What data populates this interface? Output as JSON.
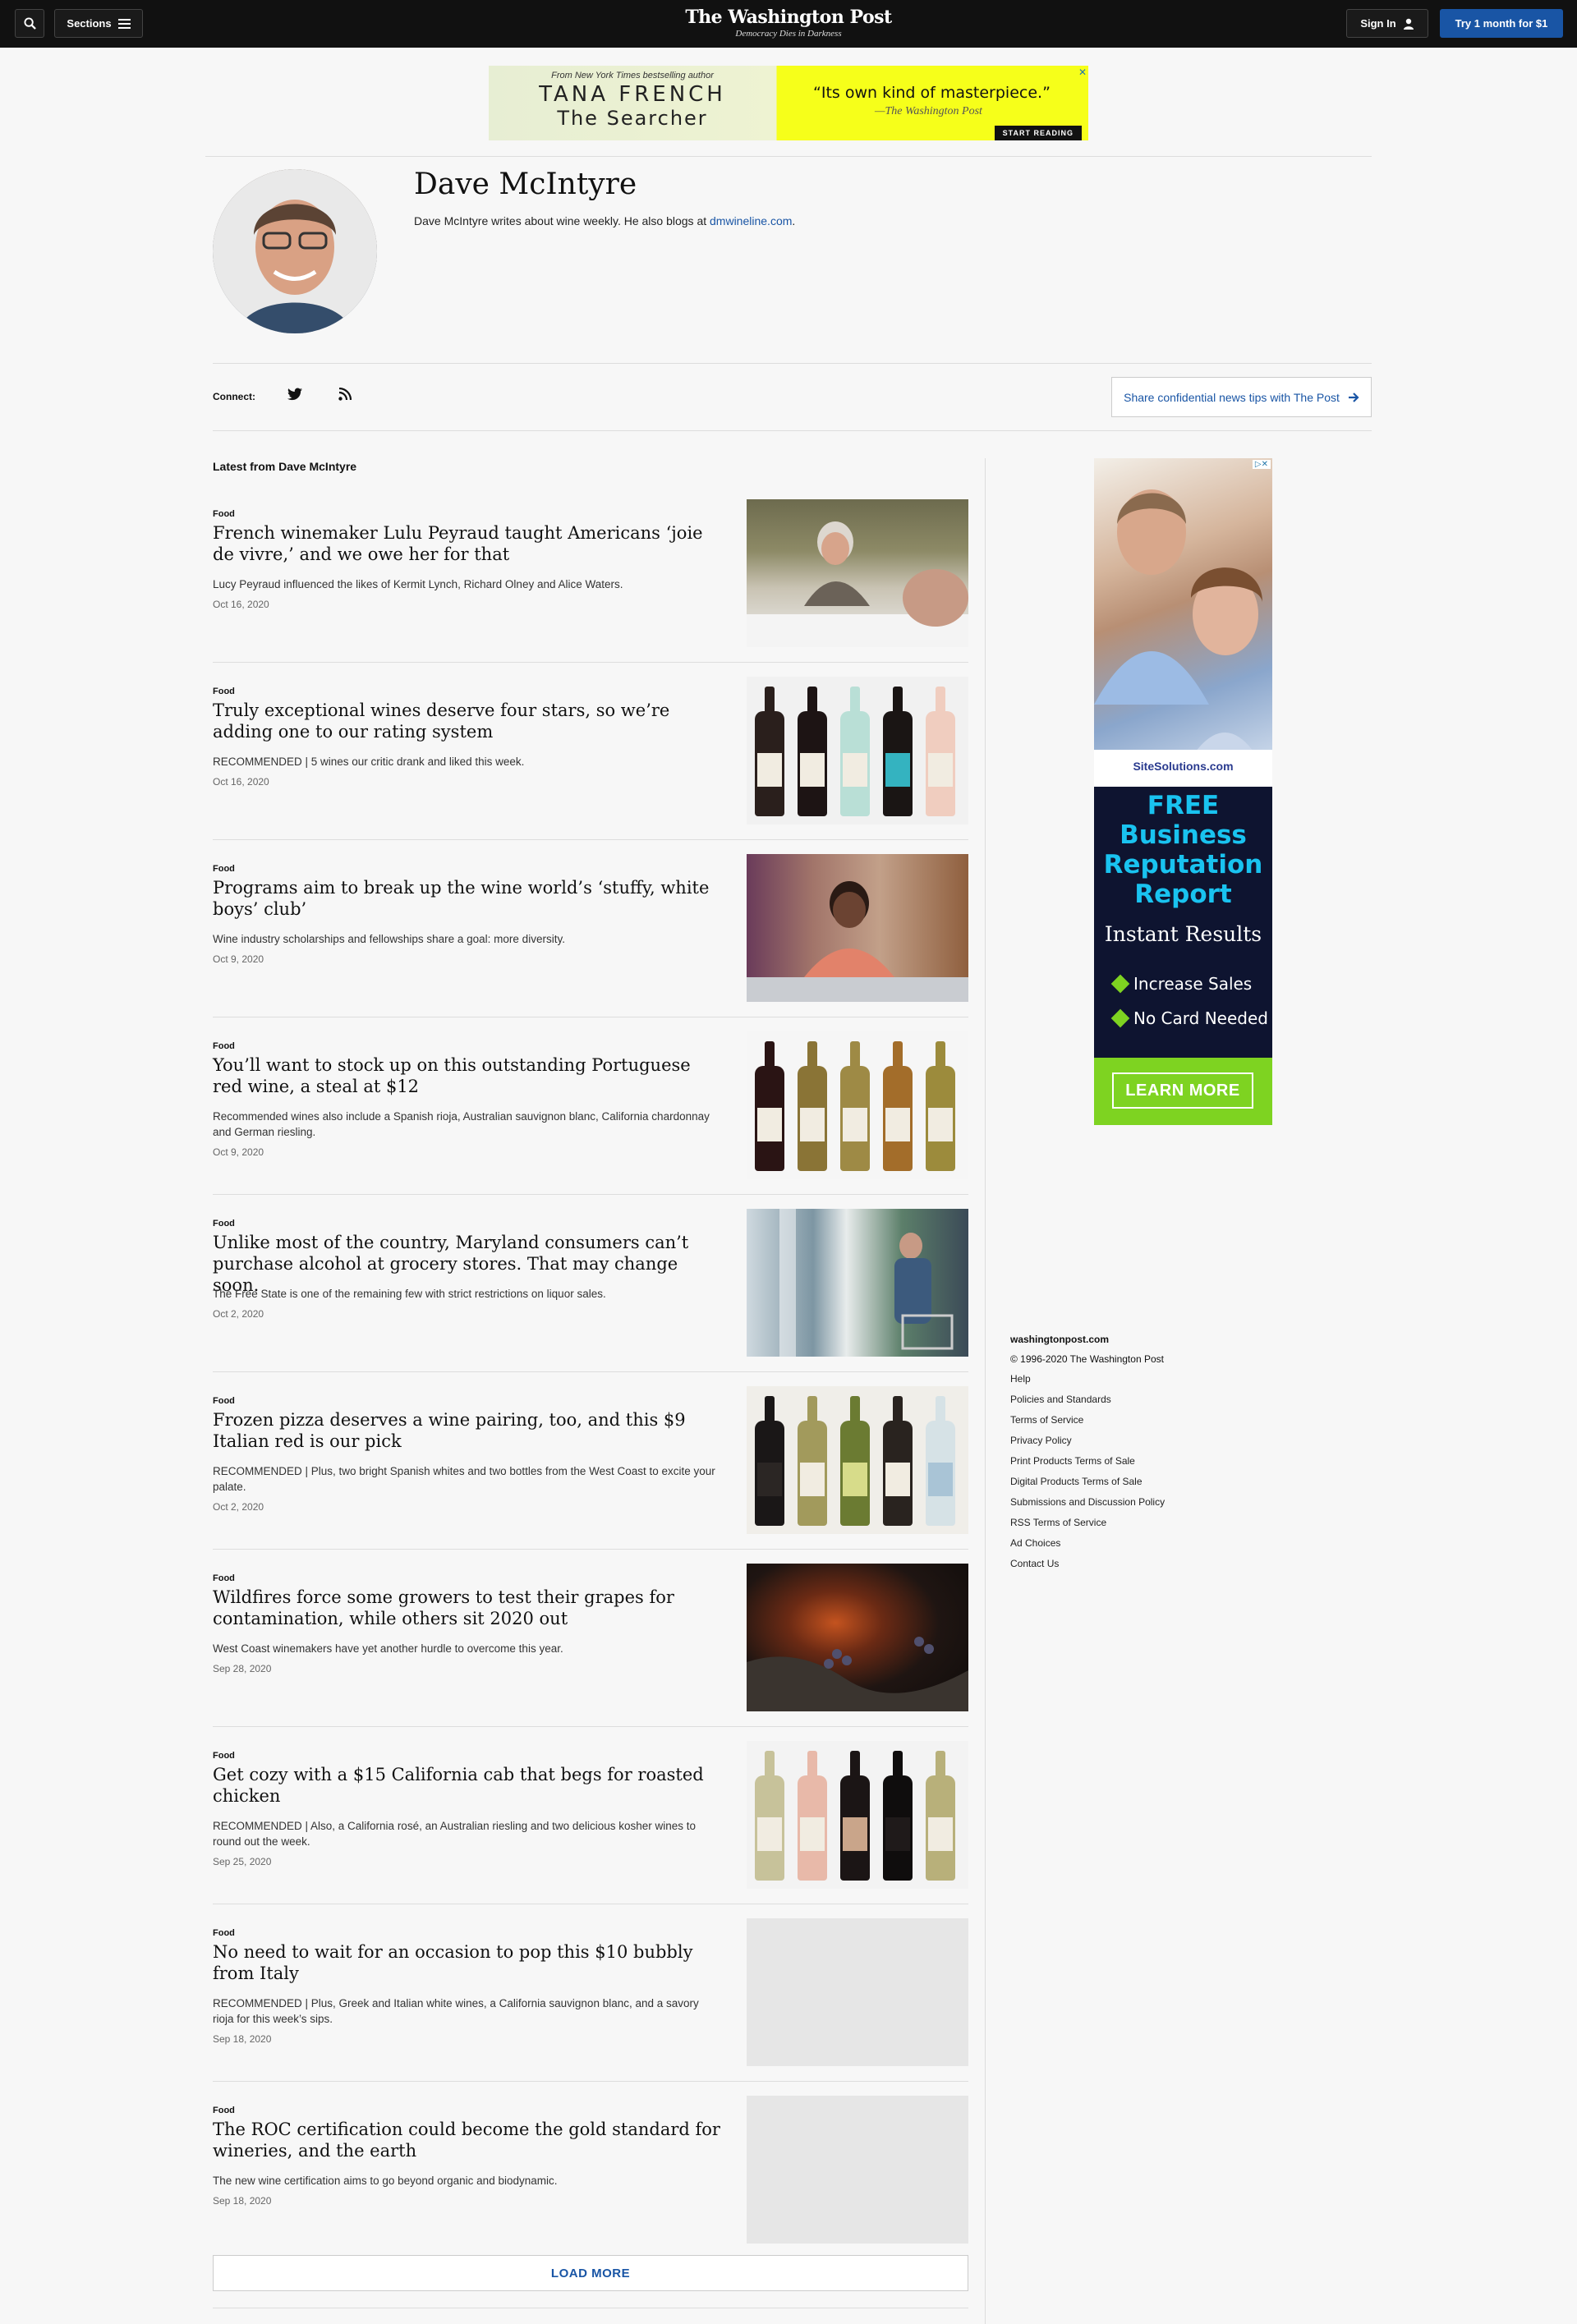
{
  "header": {
    "sections_label": "Sections",
    "logo": "The Washington Post",
    "tagline": "Democracy Dies in Darkness",
    "signin_label": "Sign In",
    "try_label": "Try 1 month for $1"
  },
  "top_ad": {
    "from_text": "From New York Times bestselling author",
    "author": "TANA FRENCH",
    "book": "The Searcher",
    "quote": "“Its own kind of masterpiece.”",
    "quote_source": "—The Washington Post",
    "cta": "START READING"
  },
  "author": {
    "name": "Dave McIntyre",
    "bio_prefix": "Dave McIntyre writes about wine weekly. He also blogs at ",
    "bio_link": "dmwineline.com",
    "bio_suffix": "."
  },
  "connect": {
    "label": "Connect:",
    "tips_button": "Share confidential news tips with The Post"
  },
  "latest_label": "Latest from Dave McIntyre",
  "articles": [
    {
      "kicker": "Food",
      "headline": "French winemaker Lulu Peyraud taught Americans ‘joie de vivre,’ and we owe her for that",
      "blurb": "Lucy Peyraud influenced the likes of Kermit Lynch, Richard Olney and Alice Waters.",
      "date": "Oct 16, 2020"
    },
    {
      "kicker": "Food",
      "headline": "Truly exceptional wines deserve four stars, so we’re adding one to our rating system",
      "blurb": "RECOMMENDED | 5 wines our critic drank and liked this week.",
      "date": "Oct 16, 2020"
    },
    {
      "kicker": "Food",
      "headline": "Programs aim to break up the wine world’s ‘stuffy, white boys’ club’",
      "blurb": "Wine industry scholarships and fellowships share a goal: more diversity.",
      "date": "Oct 9, 2020"
    },
    {
      "kicker": "Food",
      "headline": "You’ll want to stock up on this outstanding Portuguese red wine, a steal at $12",
      "blurb": "Recommended wines also include a Spanish rioja, Australian sauvignon blanc, California chardonnay and German riesling.",
      "date": "Oct 9, 2020"
    },
    {
      "kicker": "Food",
      "headline": "Unlike most of the country, Maryland consumers can’t purchase alcohol at grocery stores. That may change soon.",
      "blurb": "The Free State is one of the remaining few with strict restrictions on liquor sales.",
      "date": "Oct 2, 2020"
    },
    {
      "kicker": "Food",
      "headline": "Frozen pizza deserves a wine pairing, too, and this $9 Italian red is our pick",
      "blurb": "RECOMMENDED | Plus, two bright Spanish whites and two bottles from the West Coast to excite your palate.",
      "date": "Oct 2, 2020"
    },
    {
      "kicker": "Food",
      "headline": "Wildfires force some growers to test their grapes for contamination, while others sit 2020 out",
      "blurb": "West Coast winemakers have yet another hurdle to overcome this year.",
      "date": "Sep 28, 2020"
    },
    {
      "kicker": "Food",
      "headline": "Get cozy with a $15 California cab that begs for roasted chicken",
      "blurb": "RECOMMENDED | Also, a California rosé, an Australian riesling and two delicious kosher wines to round out the week.",
      "date": "Sep 25, 2020"
    },
    {
      "kicker": "Food",
      "headline": "No need to wait for an occasion to pop this $10 bubbly from Italy",
      "blurb": "RECOMMENDED | Plus, Greek and Italian white wines, a California sauvignon blanc, and a savory rioja for this week’s sips.",
      "date": "Sep 18, 2020"
    },
    {
      "kicker": "Food",
      "headline": "The ROC certification could become the gold standard for wineries, and the earth",
      "blurb": "The new wine certification aims to go beyond organic and biodynamic.",
      "date": "Sep 18, 2020"
    }
  ],
  "load_more": "LOAD MORE",
  "side_ad": {
    "site": "SiteSolutions.com",
    "free_lines": [
      "FREE",
      "Business",
      "Reputation",
      "Report"
    ],
    "instant": "Instant Results",
    "bullets": [
      "Increase Sales",
      "No Card Needed"
    ],
    "cta": "LEARN MORE"
  },
  "footer": {
    "site": "washingtonpost.com",
    "copyright": "© 1996-2020 The Washington Post",
    "links": [
      "Help",
      "Policies and Standards",
      "Terms of Service",
      "Privacy Policy",
      "Print Products Terms of Sale",
      "Digital Products Terms of Sale",
      "Submissions and Discussion Policy",
      "RSS Terms of Service",
      "Ad Choices",
      "Contact Us"
    ]
  },
  "colors": {
    "accent": "#1955a5",
    "header_bg": "#111111",
    "page_bg": "#f7f7f7"
  }
}
